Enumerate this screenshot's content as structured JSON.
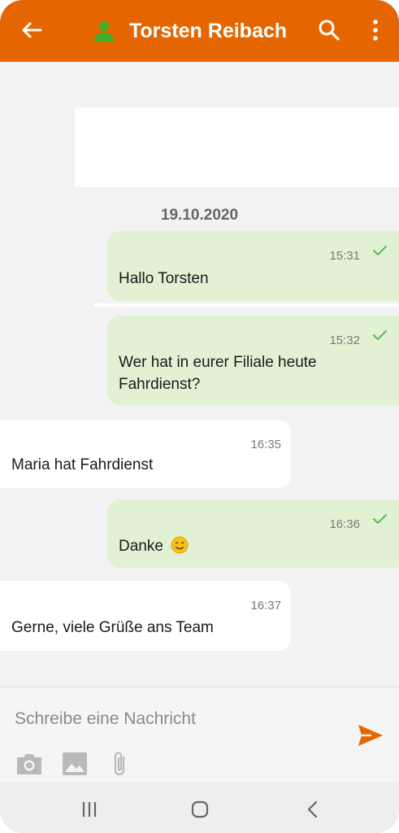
{
  "header": {
    "title": "Torsten Reibach",
    "color": "#e56600",
    "back_icon": "arrow-left-icon",
    "contact_icon": "person-icon",
    "search_icon": "search-icon",
    "menu_icon": "more-vert-icon"
  },
  "chat": {
    "date_separator": "19.10.2020",
    "messages": [
      {
        "direction": "outgoing",
        "time": "15:31",
        "text": "Hallo Torsten",
        "status": "delivered"
      },
      {
        "direction": "outgoing",
        "time": "15:32",
        "text": "Wer hat in eurer Filiale heute Fahrdienst?",
        "status": "delivered"
      },
      {
        "direction": "incoming",
        "time": "16:35",
        "text": "Maria hat Fahrdienst"
      },
      {
        "direction": "outgoing",
        "time": "16:36",
        "text": "Danke",
        "emoji": "smiling-face-icon",
        "status": "delivered"
      },
      {
        "direction": "incoming",
        "time": "16:37",
        "text": "Gerne, viele Grüße ans Team"
      }
    ],
    "outgoing_bubble_color": "#e2f1d4",
    "incoming_bubble_color": "#ffffff",
    "check_color": "#5cb85c"
  },
  "composer": {
    "placeholder": "Schreibe eine Nachricht",
    "send_icon": "send-icon",
    "tools": [
      "camera-icon",
      "image-icon",
      "attachment-icon"
    ]
  },
  "navbar": {
    "buttons": [
      "recent-apps-icon",
      "home-icon",
      "back-icon"
    ]
  }
}
